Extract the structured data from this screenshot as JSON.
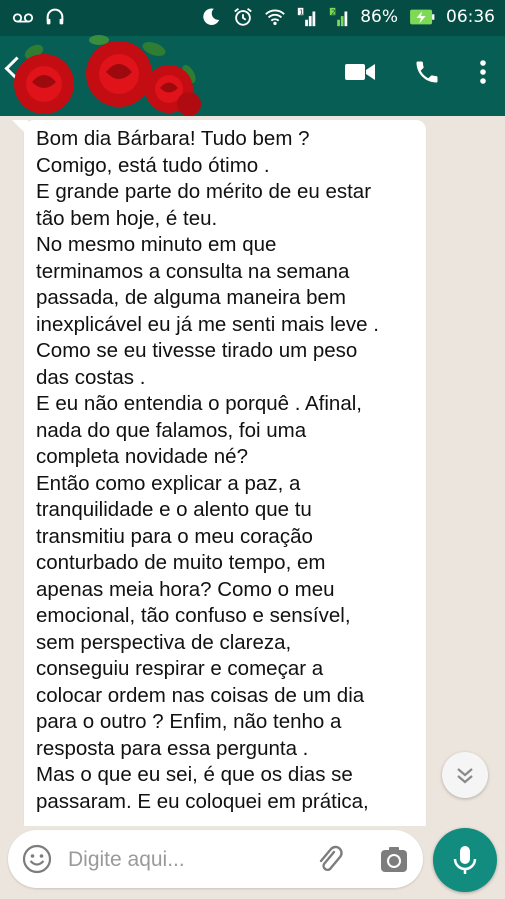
{
  "status_bar": {
    "battery": "86%",
    "time": "06:36",
    "sim1": "1",
    "sim2": "2"
  },
  "app_bar": {
    "icons": [
      "back-arrow-icon",
      "video-call-icon",
      "phone-icon",
      "more-options-icon"
    ]
  },
  "colors": {
    "status_bar": "#054d44",
    "app_bar": "#075e54",
    "chat_bg": "#ece5dd",
    "mic_button": "#128c7e"
  },
  "message": {
    "lines": [
      "Bom dia Bárbara! Tudo bem ?",
      "Comigo, está tudo ótimo .",
      "E grande parte do mérito de eu estar",
      "tão bem hoje, é  teu.",
      "No mesmo minuto em que",
      "terminamos a consulta na semana",
      "passada, de alguma maneira bem",
      "inexplicável eu já me senti mais leve .",
      "Como se eu tivesse tirado um peso",
      "das costas .",
      "E eu não entendia o porquê .  Afinal,",
      "nada do que falamos, foi uma",
      "completa novidade né?",
      "Então como explicar a paz,  a",
      "tranquilidade e o alento que tu",
      "transmitiu para o meu coração",
      "conturbado de muito tempo, em",
      "apenas meia hora? Como o meu",
      "emocional,  tão confuso e sensível,",
      "sem perspectiva de clareza,",
      "conseguiu respirar e começar a",
      "colocar ordem nas coisas de um dia",
      "para o outro ? Enfim, não tenho a",
      "resposta para essa pergunta .",
      "Mas o que eu sei, é  que os dias se",
      "passaram. E eu coloquei em prática,"
    ]
  },
  "input": {
    "placeholder": "Digite aqui..."
  }
}
